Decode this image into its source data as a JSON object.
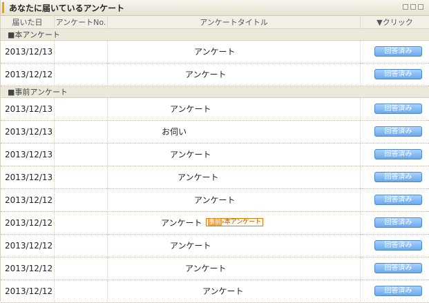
{
  "panel": {
    "title": "あなたに届いているアンケート"
  },
  "columns": {
    "received": "届いた日",
    "number": "アンケートNo.",
    "title": "アンケートタイトル",
    "click": "▼クリック"
  },
  "sections": [
    {
      "label": "■本アンケート",
      "rows": [
        {
          "date": "2013/12/13",
          "title": "アンケート",
          "button": "回答済み"
        },
        {
          "date": "2013/12/12",
          "title": "アンケート",
          "button": "回答済み"
        }
      ]
    },
    {
      "label": "■事前アンケート",
      "rows": [
        {
          "date": "2013/12/13",
          "title": "アンケート",
          "button": "回答済み"
        },
        {
          "date": "2013/12/13",
          "title": "お伺い",
          "button": "回答済み"
        },
        {
          "date": "2013/12/13",
          "title": "アンケート",
          "button": "回答済み"
        },
        {
          "date": "2013/12/13",
          "title": "アンケート",
          "button": "回答済み"
        },
        {
          "date": "2013/12/12",
          "title": "アンケート",
          "button": "回答済み"
        },
        {
          "date": "2013/12/12",
          "title": "アンケート",
          "button": "回答済み",
          "tag_a": "事前",
          "tag_b": "›本アンケート"
        },
        {
          "date": "2013/12/12",
          "title": "アンケート",
          "button": "回答済み"
        },
        {
          "date": "2013/12/12",
          "title": "アンケート",
          "button": "回答済み"
        },
        {
          "date": "2013/12/12",
          "title": "アンケート",
          "button": "回答済み"
        }
      ]
    }
  ],
  "colors": {
    "accent": "#f0a000",
    "button": "#6ba8ec",
    "tag_border": "#e07a00"
  }
}
